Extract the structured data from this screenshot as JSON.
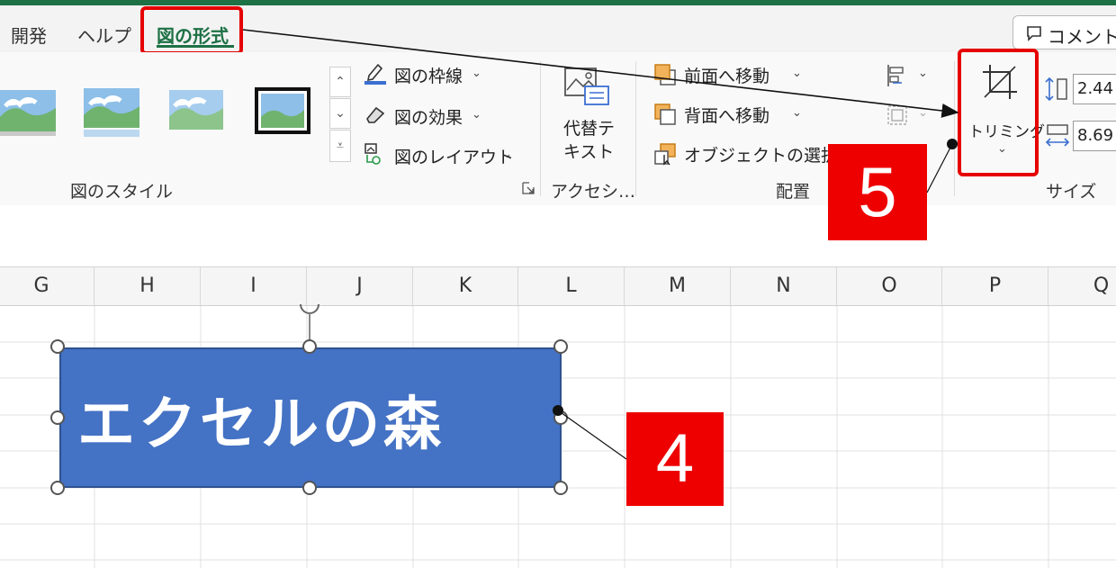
{
  "tabs": [
    {
      "label": "開発"
    },
    {
      "label": "ヘルプ"
    },
    {
      "label": "図の形式",
      "active": true
    }
  ],
  "comment_button": {
    "label": "コメント"
  },
  "ribbon": {
    "picture_styles": {
      "label": "図のスタイル",
      "commands": [
        {
          "label": "図の枠線"
        },
        {
          "label": "図の効果"
        },
        {
          "label": "図のレイアウト"
        }
      ]
    },
    "accessibility": {
      "label": "アクセシ…",
      "alt_text_line1": "代替テ",
      "alt_text_line2": "キスト"
    },
    "arrange": {
      "label": "配置",
      "commands": [
        {
          "label": "前面へ移動"
        },
        {
          "label": "背面へ移動"
        },
        {
          "label": "オブジェクトの選択と"
        }
      ]
    },
    "size": {
      "label": "サイズ",
      "crop_label": "トリミング",
      "height_value": "2.44",
      "width_value": "8.69"
    }
  },
  "columns": [
    "G",
    "H",
    "I",
    "J",
    "K",
    "L",
    "M",
    "N",
    "O",
    "P",
    "Q"
  ],
  "shape": {
    "text": "エクセルの森",
    "fill_color": "#4472c4"
  },
  "callouts": [
    {
      "number": "4"
    },
    {
      "number": "5"
    }
  ],
  "colors": {
    "accent": "#1e7145",
    "highlight": "#e60000"
  }
}
